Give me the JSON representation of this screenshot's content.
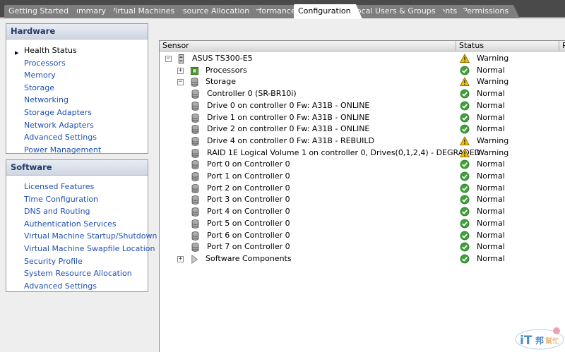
{
  "tabs": [
    {
      "label": "Getting Started",
      "active": false
    },
    {
      "label": "Summary",
      "active": false
    },
    {
      "label": "Virtual Machines",
      "active": false
    },
    {
      "label": "Resource Allocation",
      "active": false
    },
    {
      "label": "Performance",
      "active": false
    },
    {
      "label": "Configuration",
      "active": true
    },
    {
      "label": "Local Users & Groups",
      "active": false
    },
    {
      "label": "Events",
      "active": false
    },
    {
      "label": "Permissions",
      "active": false
    }
  ],
  "hardware": {
    "title": "Hardware",
    "items": [
      {
        "label": "Health Status",
        "selected": true
      },
      {
        "label": "Processors"
      },
      {
        "label": "Memory"
      },
      {
        "label": "Storage"
      },
      {
        "label": "Networking"
      },
      {
        "label": "Storage Adapters"
      },
      {
        "label": "Network Adapters"
      },
      {
        "label": "Advanced Settings"
      },
      {
        "label": "Power Management"
      }
    ]
  },
  "software": {
    "title": "Software",
    "items": [
      {
        "label": "Licensed Features"
      },
      {
        "label": "Time Configuration"
      },
      {
        "label": "DNS and Routing"
      },
      {
        "label": "Authentication Services"
      },
      {
        "label": "Virtual Machine Startup/Shutdown"
      },
      {
        "label": "Virtual Machine Swapfile Location"
      },
      {
        "label": "Security Profile"
      },
      {
        "label": "System Resource Allocation"
      },
      {
        "label": "Advanced Settings"
      }
    ]
  },
  "sensor_table": {
    "columns": {
      "sensor": "Sensor",
      "status": "Status",
      "extra": "R"
    },
    "rows": [
      {
        "name": "ASUS TS300-E5",
        "status": "Warning",
        "icon": "server-icon",
        "expander": "minus"
      },
      {
        "name": "Processors",
        "status": "Normal",
        "icon": "processor-icon",
        "expander": "plus"
      },
      {
        "name": "Storage",
        "status": "Warning",
        "icon": "storage-icon",
        "expander": "minus"
      },
      {
        "name": "Controller 0 (SR-BR10i)",
        "status": "Normal",
        "icon": "disk-icon"
      },
      {
        "name": "Drive 0 on controller 0 Fw: A31B - ONLINE",
        "status": "Normal",
        "icon": "disk-icon"
      },
      {
        "name": "Drive 1 on controller 0 Fw: A31B - ONLINE",
        "status": "Normal",
        "icon": "disk-icon"
      },
      {
        "name": "Drive 2 on controller 0 Fw: A31B - ONLINE",
        "status": "Normal",
        "icon": "disk-icon"
      },
      {
        "name": "Drive 4 on controller 0 Fw: A31B - REBUILD",
        "status": "Warning",
        "icon": "disk-icon"
      },
      {
        "name": "RAID 1E Logical Volume 1 on controller 0, Drives(0,1,2,4)  - DEGRADED",
        "status": "Warning",
        "icon": "disk-icon"
      },
      {
        "name": "Port 0 on Controller 0",
        "status": "Normal",
        "icon": "disk-icon"
      },
      {
        "name": "Port 1 on Controller 0",
        "status": "Normal",
        "icon": "disk-icon"
      },
      {
        "name": "Port 2 on Controller 0",
        "status": "Normal",
        "icon": "disk-icon"
      },
      {
        "name": "Port 3 on Controller 0",
        "status": "Normal",
        "icon": "disk-icon"
      },
      {
        "name": "Port 4 on Controller 0",
        "status": "Normal",
        "icon": "disk-icon"
      },
      {
        "name": "Port 5 on Controller 0",
        "status": "Normal",
        "icon": "disk-icon"
      },
      {
        "name": "Port 6 on Controller 0",
        "status": "Normal",
        "icon": "disk-icon"
      },
      {
        "name": "Port 7 on Controller 0",
        "status": "Normal",
        "icon": "disk-icon"
      },
      {
        "name": "Software Components",
        "status": "Normal",
        "icon": "software-icon",
        "expander": "plus"
      }
    ]
  },
  "watermark": {
    "text": "iT邦幫忙"
  },
  "colors": {
    "warning": "#f2c200",
    "normal": "#3fa13a",
    "link": "#2050b8",
    "tabbar": "#4a4a4a"
  }
}
